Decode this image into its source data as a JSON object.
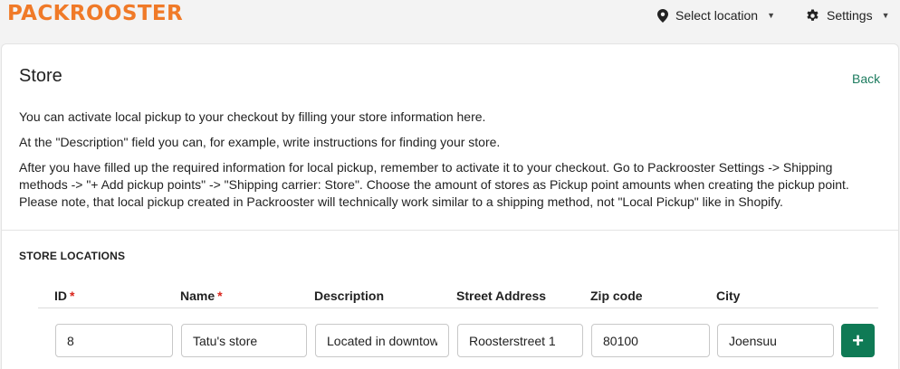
{
  "header": {
    "logo_text": "PACKROOSTER",
    "location_label": "Select location",
    "settings_label": "Settings",
    "location_icon": "map-pin-icon",
    "settings_icon": "gear-icon",
    "brand_color": "#f07a28"
  },
  "page": {
    "title": "Store",
    "back_label": "Back",
    "paragraphs": [
      "You can activate local pickup to your checkout by filling your store information here.",
      "At the \"Description\" field you can, for example, write instructions for finding your store.",
      "After you have filled up the required information for local pickup, remember to activate it to your checkout. Go to Packrooster Settings -> Shipping methods -> \"+ Add pickup points\" -> \"Shipping carrier: Store\". Choose the amount of stores as Pickup point amounts when creating the pickup point. Please note, that local pickup created in Packrooster will technically work similar to a shipping method, not \"Local Pickup\" like in Shopify."
    ]
  },
  "store_locations": {
    "title": "STORE LOCATIONS",
    "columns": {
      "id": "ID",
      "name": "Name",
      "description": "Description",
      "street": "Street Address",
      "zip": "Zip code",
      "city": "City"
    },
    "required_marker": "*",
    "row": {
      "id": "8",
      "name": "Tatu's store",
      "description": "Located in downtown",
      "street": "Roosterstreet 1",
      "zip": "80100",
      "city": "Joensuu"
    },
    "add_button_label": "+",
    "accent_color": "#0f7a55"
  }
}
